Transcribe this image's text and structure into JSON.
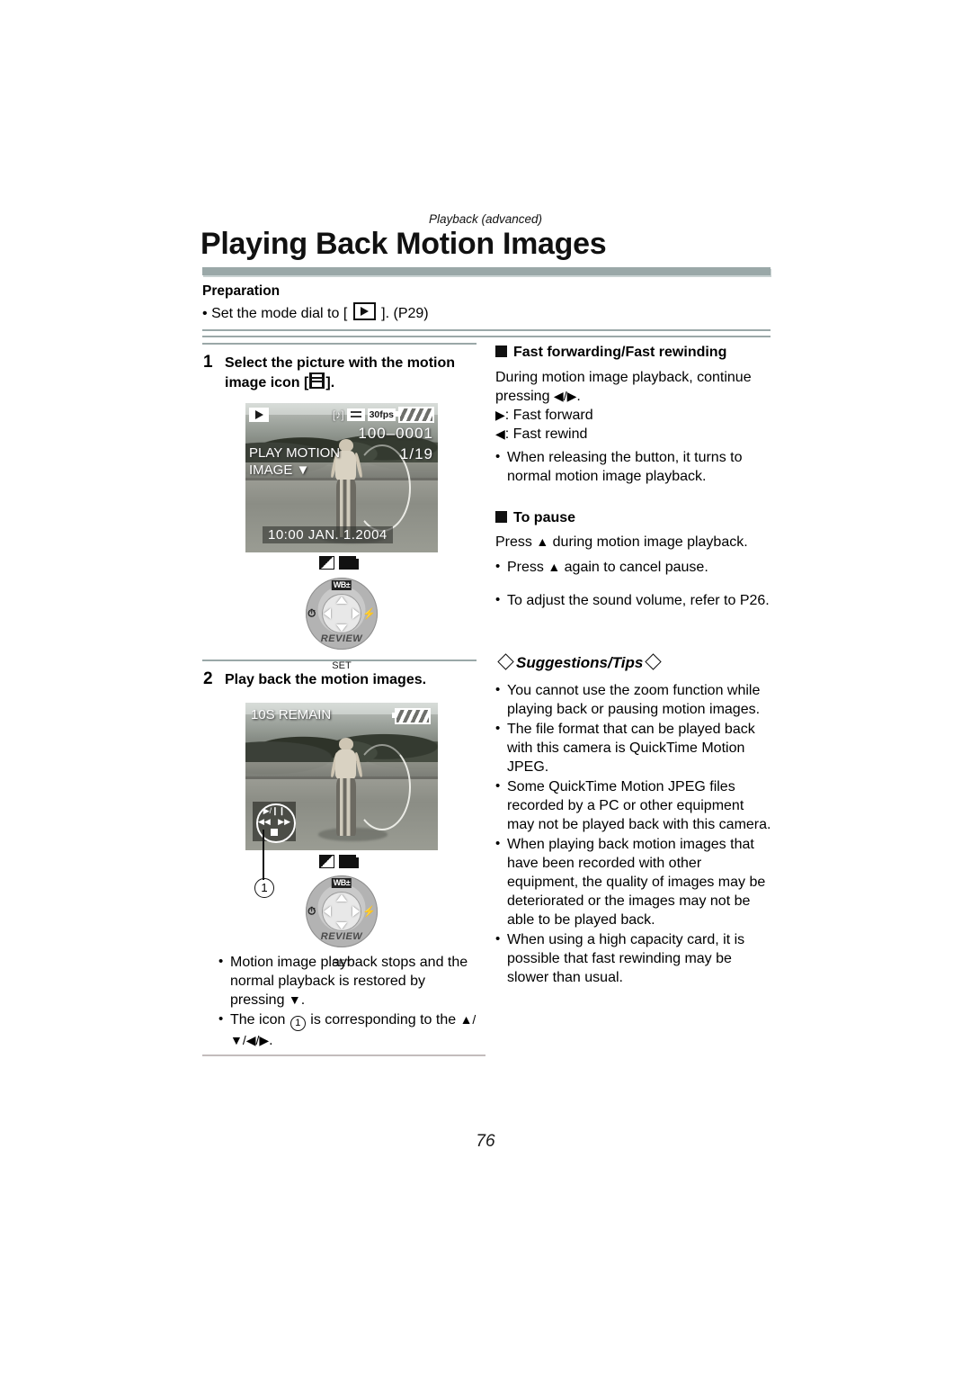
{
  "header": {
    "kicker": "Playback (advanced)",
    "title": "Playing Back Motion Images"
  },
  "preparation": {
    "heading": "Preparation",
    "bullet_prefix": "Set the mode dial to [",
    "bullet_suffix": "]. (P29)",
    "mode_icon": "playback-icon"
  },
  "left_column": {
    "step1": {
      "number": "1",
      "text_before_icon": "Select the picture with the motion image icon [",
      "text_after_icon": "]."
    },
    "step2": {
      "number": "2",
      "text": "Play back the motion images."
    },
    "lcd1": {
      "play_icon": "play-icon",
      "audio_icon": "[♪]",
      "film_icon": "motion-image-icon",
      "fps": "30fps",
      "battery_icon": "battery-icon",
      "file_number": "100–0001",
      "frame_count": "1/19",
      "label_line1": "PLAY MOTION",
      "label_line2": "IMAGE ▼",
      "datetime": "10:00  JAN. 1.2004"
    },
    "lcd2": {
      "remain": "10S REMAIN",
      "battery_icon": "battery-icon",
      "controls": {
        "play_pause": "▶/❙❙",
        "rewind": "◀◀",
        "forward": "▶▶",
        "stop": "stop-icon"
      }
    },
    "dial": {
      "wb_label": "WB±",
      "self_timer_icon": "self-timer-icon",
      "flash_icon": "flash-icon",
      "review_label": "REVIEW",
      "set_label": "SET",
      "ev_icon": "exposure-compensation-icon",
      "burst_icon": "burst-mode-icon"
    },
    "callout_number": "1",
    "notes": [
      {
        "before": "Motion image playback stops and the normal playback is restored by pressing ",
        "glyph": "▼",
        "after": "."
      },
      {
        "before": "The icon ",
        "circled": "1",
        "middle": " is corresponding to the ",
        "glyph": "▲/▼/◀/▶",
        "after": "."
      }
    ]
  },
  "right_column": {
    "fast_forward": {
      "heading": "Fast forwarding/Fast rewinding",
      "body_before": "During motion image playback, continue pressing ",
      "body_glyph": "◀/▶",
      "body_after": ".",
      "items": [
        {
          "glyph": "▶",
          "label": ": Fast forward"
        },
        {
          "glyph": "◀",
          "label": ": Fast rewind"
        }
      ],
      "note": "When releasing the button, it turns to normal motion image playback."
    },
    "to_pause": {
      "heading": "To pause",
      "body_before": "Press ",
      "body_glyph": "▲",
      "body_after": " during motion image playback.",
      "notes": [
        {
          "before": "Press ",
          "glyph": "▲",
          "after": " again to cancel pause."
        },
        {
          "before": "To adjust the sound volume, refer to P26.",
          "glyph": "",
          "after": ""
        }
      ]
    },
    "tips": {
      "heading": "Suggestions/Tips",
      "items": [
        "You cannot use the zoom function while playing back or pausing motion images.",
        "The file format that can be played back with this camera is QuickTime Motion JPEG.",
        "Some QuickTime Motion JPEG files recorded by a PC or other equipment may not be played back with this camera.",
        "When playing back motion images that have been recorded with other equipment, the quality of images may be deteriorated or the images may not be able to be played back.",
        "When using a high capacity card, it is possible that fast rewinding may be slower than usual."
      ]
    }
  },
  "page_number": "76"
}
